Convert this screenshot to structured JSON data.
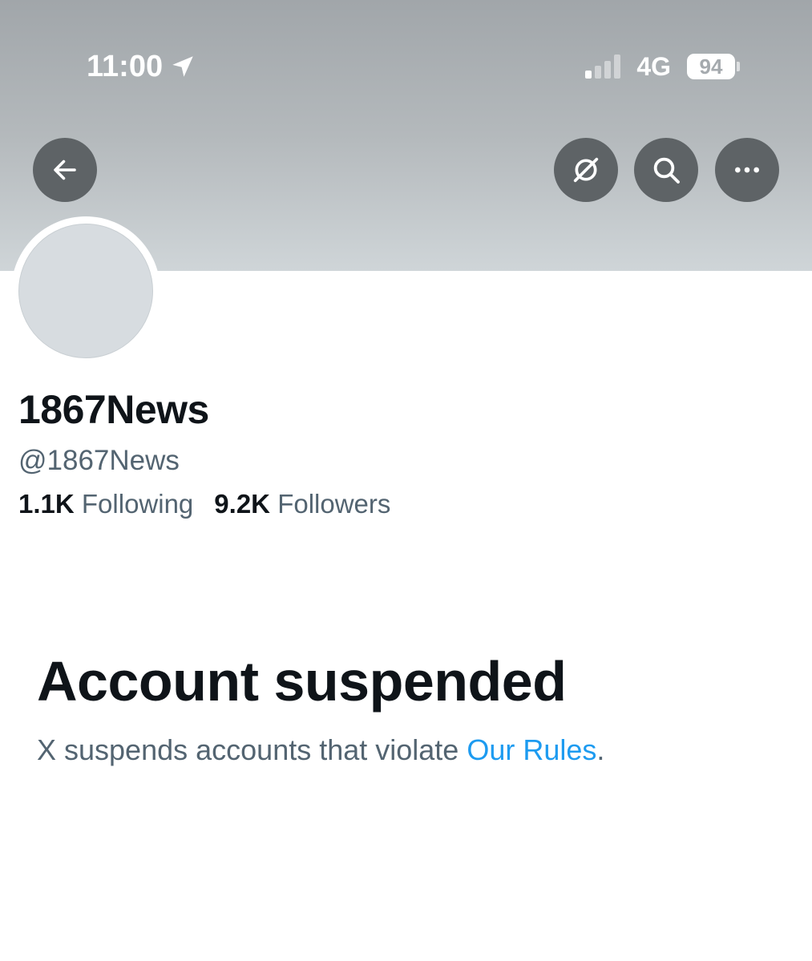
{
  "status_bar": {
    "time": "11:00",
    "network": "4G",
    "battery": "94",
    "location_icon": "location-arrow-icon",
    "signal_icon": "cellular-signal-icon"
  },
  "header": {
    "buttons": [
      {
        "name": "back-button",
        "icon": "arrow-left-icon"
      },
      {
        "name": "grok-button",
        "icon": "grok-icon"
      },
      {
        "name": "search-button",
        "icon": "search-icon"
      },
      {
        "name": "more-button",
        "icon": "more-horizontal-icon"
      }
    ],
    "button_bg": "#5e6366"
  },
  "profile": {
    "display_name": "1867News",
    "handle": "@1867News",
    "following_count": "1.1K",
    "following_label": "Following",
    "followers_count": "9.2K",
    "followers_label": "Followers"
  },
  "notice": {
    "title": "Account suspended",
    "description_prefix": "X suspends accounts that violate ",
    "link_text": "Our Rules",
    "description_suffix": "."
  },
  "colors": {
    "text_primary": "#0f1419",
    "text_secondary": "#536471",
    "link": "#1d9bf0"
  }
}
